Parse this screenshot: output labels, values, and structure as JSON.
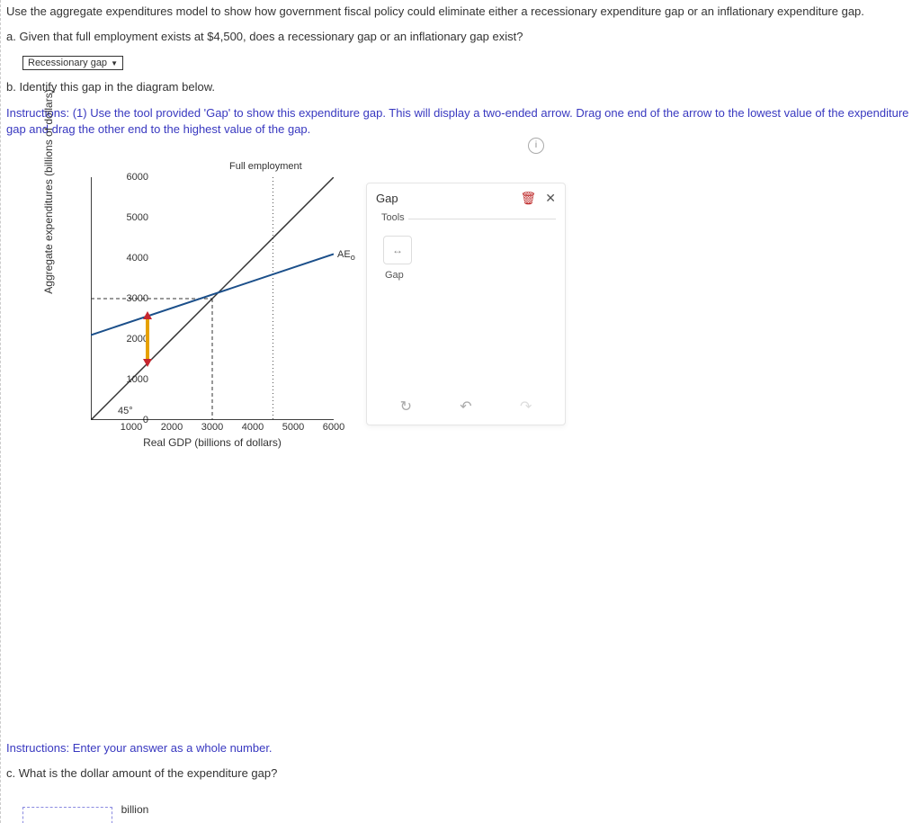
{
  "intro": "Use the aggregate expenditures model to show how government fiscal policy could eliminate either a recessionary expenditure gap or an inflationary expenditure gap.",
  "part_a": "a. Given that full employment exists at $4,500, does a recessionary gap or an inflationary gap exist?",
  "dropdown_value": "Recessionary gap",
  "part_b": "b. Identify this gap in the diagram below.",
  "instructions_label": "Instructions:",
  "instructions_text": " (1) Use the tool provided 'Gap' to show this expenditure gap. This will display a two-ended arrow. Drag one end of the arrow to the lowest value of the expenditure gap and drag the other end to the highest value of the gap.",
  "chart_data": {
    "type": "line",
    "xlabel": "Real GDP (billions of dollars)",
    "ylabel": "Aggregate expenditures (billions of dollars)",
    "xlim": [
      0,
      6000
    ],
    "ylim": [
      0,
      6000
    ],
    "xticks": [
      1000,
      2000,
      3000,
      4000,
      5000,
      6000
    ],
    "yticks": [
      0,
      1000,
      2000,
      3000,
      4000,
      5000,
      6000
    ],
    "series": [
      {
        "name": "45°",
        "type": "line",
        "points": [
          [
            0,
            0
          ],
          [
            6000,
            6000
          ]
        ],
        "color": "#333"
      },
      {
        "name": "AE₀",
        "type": "line",
        "points": [
          [
            0,
            2100
          ],
          [
            6000,
            4100
          ]
        ],
        "color": "#1b4f8a"
      }
    ],
    "annotations": [
      {
        "text": "Full employment",
        "x": 4500,
        "y": 6300,
        "type": "header-label"
      },
      {
        "type": "vline-dotted",
        "x": 4500,
        "from_y": 0,
        "to_y": 6000
      },
      {
        "type": "vline-dashed",
        "x": 3000,
        "from_y": 0,
        "to_y": 3000
      },
      {
        "type": "hline-dashed",
        "y": 3000,
        "from_x": 0,
        "to_x": 3000
      },
      {
        "text": "45°",
        "x": 700,
        "y": 200
      },
      {
        "text": "AE₀",
        "x": 6200,
        "y": 4100,
        "subscript": "o",
        "base": "AE"
      },
      {
        "type": "gap-arrow",
        "x": 1400,
        "from_y": 1400,
        "to_y": 2600
      }
    ]
  },
  "panel": {
    "title": "Gap",
    "tools_legend": "Tools",
    "tool_name": "Gap"
  },
  "instructions2_label": "Instructions:",
  "instructions2_text": " Enter your answer as a whole number.",
  "part_c": "c. What is the dollar amount of the expenditure gap?",
  "unit": "billion"
}
